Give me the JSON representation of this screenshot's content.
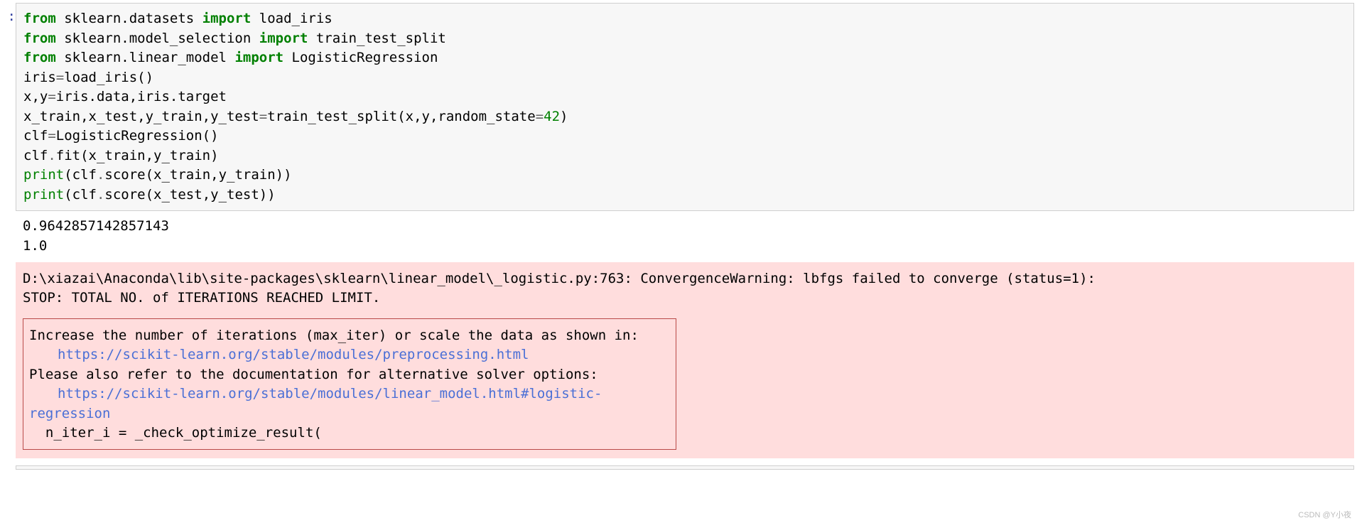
{
  "prompt": ":",
  "code": {
    "l1_kw1": "from",
    "l1_mod": " sklearn.datasets ",
    "l1_kw2": "import",
    "l1_rest": " load_iris",
    "l2_kw1": "from",
    "l2_mod": " sklearn.model_selection ",
    "l2_kw2": "import",
    "l2_rest": " train_test_split",
    "l3_kw1": "from",
    "l3_mod": " sklearn.linear_model ",
    "l3_kw2": "import",
    "l3_rest": " LogisticRegression",
    "l4a": "iris",
    "l4op": "=",
    "l4b": "load_iris()",
    "l5a": "x,y",
    "l5op": "=",
    "l5b": "iris.data,iris.target",
    "l6a": "x_train,x_test,y_train,y_test",
    "l6op": "=",
    "l6b": "train_test_split(x,y,random_state",
    "l6op2": "=",
    "l6num": "42",
    "l6c": ")",
    "l7a": "clf",
    "l7op": "=",
    "l7b": "LogisticRegression()",
    "l8a": "clf",
    "l8op": ".",
    "l8b": "fit(x_train,y_train)",
    "l9fn": "print",
    "l9a": "(clf",
    "l9op": ".",
    "l9b": "score(x_train,y_train))",
    "l10fn": "print",
    "l10a": "(clf",
    "l10op": ".",
    "l10b": "score(x_test,y_test))"
  },
  "stdout": {
    "line1": "0.9642857142857143",
    "line2": "1.0"
  },
  "stderr": {
    "header_l1": "D:\\xiazai\\Anaconda\\lib\\site-packages\\sklearn\\linear_model\\_logistic.py:763: ConvergenceWarning: lbfgs failed to converge (status=1):",
    "header_l2": "STOP: TOTAL NO. of ITERATIONS REACHED LIMIT.",
    "box_l1": "Increase the number of iterations (max_iter) or scale the data as shown in:",
    "box_link1": "https://scikit-learn.org/stable/modules/preprocessing.html",
    "box_l2": "Please also refer to the documentation for alternative solver options:",
    "box_link2": "https://scikit-learn.org/stable/modules/linear_model.html#logistic-regression",
    "box_l3": "  n_iter_i = _check_optimize_result("
  },
  "watermark": "CSDN @Y小夜"
}
